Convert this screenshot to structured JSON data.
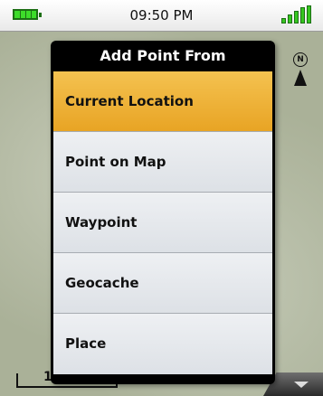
{
  "status_bar": {
    "time": "09:50 PM",
    "battery_icon": "battery-full-icon",
    "signal_icon": "signal-bars-icon"
  },
  "menu": {
    "title": "Add Point From",
    "items": [
      {
        "label": "Current Location",
        "selected": true
      },
      {
        "label": "Point on Map",
        "selected": false
      },
      {
        "label": "Waypoint",
        "selected": false
      },
      {
        "label": "Geocache",
        "selected": false
      },
      {
        "label": "Place",
        "selected": false
      }
    ]
  },
  "map": {
    "scale_label": "1",
    "north_label": "N"
  },
  "colors": {
    "selected_item": "#f0b53a",
    "status_green": "#35c61f",
    "menu_frame": "#000000"
  }
}
